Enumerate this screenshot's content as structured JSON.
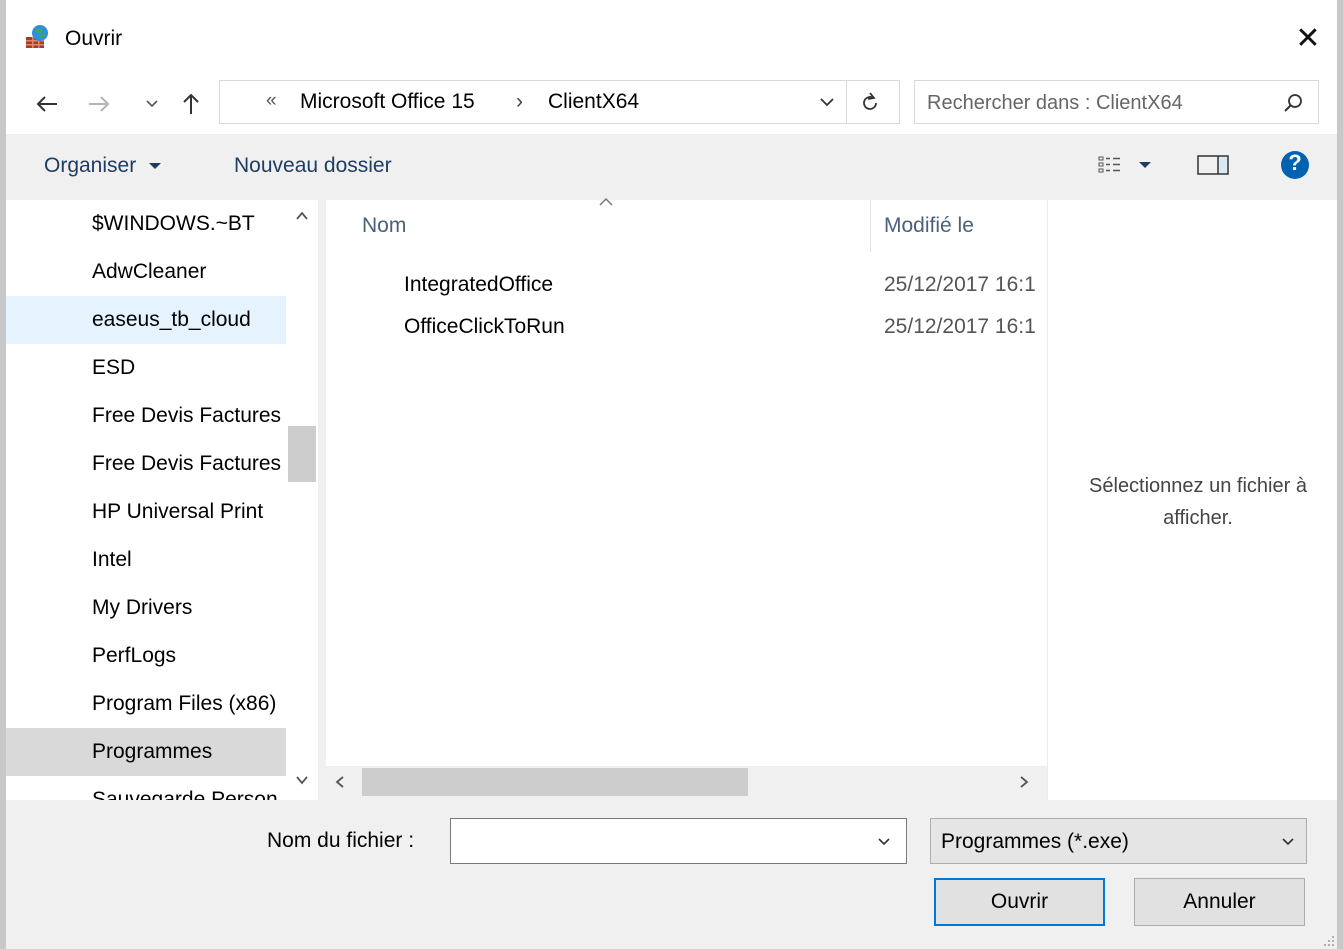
{
  "window": {
    "title": "Ouvrir",
    "close_glyph": "✕"
  },
  "navbar": {
    "address": {
      "overflow_glyph": "«",
      "crumbs": [
        "Microsoft Office 15",
        "ClientX64"
      ],
      "separator": "›"
    },
    "search_placeholder": "Rechercher dans : ClientX64"
  },
  "toolbar": {
    "organize_label": "Organiser",
    "new_folder_label": "Nouveau dossier",
    "help_glyph": "?"
  },
  "tree": {
    "items": [
      "$WINDOWS.~BT",
      "AdwCleaner",
      "easeus_tb_cloud",
      "ESD",
      "Free Devis Factures",
      "Free Devis Factures",
      "HP Universal Print",
      "Intel",
      "My Drivers",
      "PerfLogs",
      "Program Files (x86)",
      "Programmes",
      "Sauvegarde Person"
    ],
    "hovered_item": "easeus_tb_cloud",
    "selected_item": "Programmes"
  },
  "files": {
    "columns": {
      "name": "Nom",
      "modified": "Modifié le"
    },
    "rows": [
      {
        "name": "IntegratedOffice",
        "modified": "25/12/2017 16:1"
      },
      {
        "name": "OfficeClickToRun",
        "modified": "25/12/2017 16:1"
      }
    ]
  },
  "preview": {
    "message": "Sélectionnez un fichier à afficher."
  },
  "bottom": {
    "filename_label": "Nom du fichier :",
    "filename_value": "",
    "filetype_value": "Programmes (*.exe)",
    "open_label": "Ouvrir",
    "cancel_label": "Annuler"
  },
  "colors": {
    "accent": "#0078d7",
    "help": "#0063b1",
    "hover": "#e5f3ff",
    "selected": "#d9d9d9",
    "link_text": "#1f3c63"
  }
}
